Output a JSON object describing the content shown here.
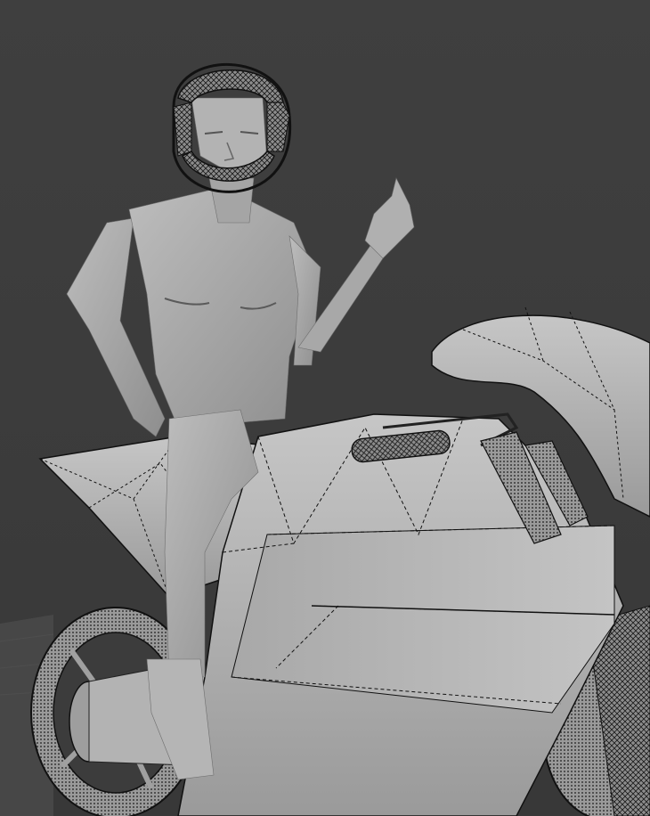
{
  "viewport": {
    "background_color": "#3c3c3c",
    "shading": "solid",
    "overlay": "wireframe-edges"
  },
  "scene": {
    "objects": [
      {
        "name": "rider-figure",
        "material_color": "#a9a9a9"
      },
      {
        "name": "helmet",
        "material_color": "#9b9b9b",
        "wireframe": true
      },
      {
        "name": "motorcycle",
        "material_color": "#b4b4b4",
        "wireframe": true
      },
      {
        "name": "ground-plane",
        "material_color": "#474747"
      }
    ]
  },
  "colors": {
    "wire": "#111111",
    "body_light": "#b8b8b8",
    "body_mid": "#a2a2a2",
    "body_dark": "#7d7d7d",
    "bike_light": "#c3c3c3",
    "bike_mid": "#adadad",
    "bike_dark": "#8a8a8a"
  }
}
